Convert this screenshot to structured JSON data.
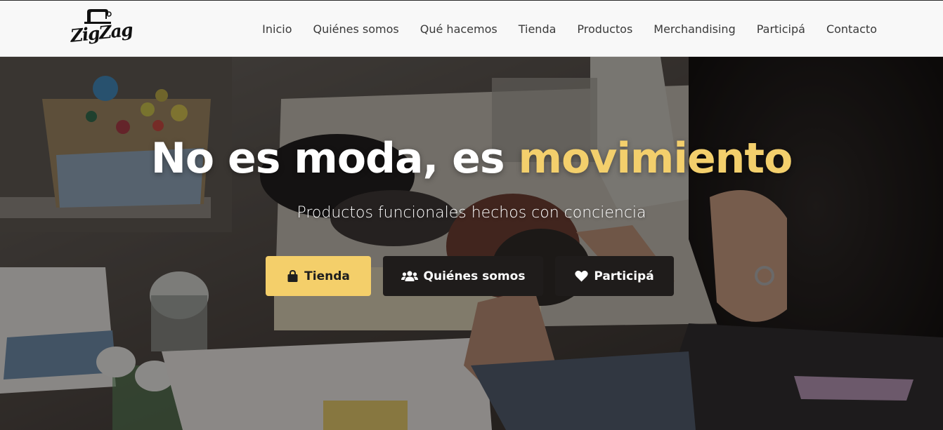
{
  "brand": {
    "logo_text": "ZigZag"
  },
  "nav": {
    "items": [
      {
        "label": "Inicio"
      },
      {
        "label": "Quiénes somos"
      },
      {
        "label": "Qué hacemos"
      },
      {
        "label": "Tienda"
      },
      {
        "label": "Productos"
      },
      {
        "label": "Merchandising"
      },
      {
        "label": "Participá"
      },
      {
        "label": "Contacto"
      }
    ]
  },
  "hero": {
    "title_main": "No es moda, es ",
    "title_accent": "movimiento",
    "subtitle": "Productos funcionales hechos con conciencia",
    "buttons": [
      {
        "label": "Tienda",
        "icon": "shopping-bag-icon"
      },
      {
        "label": "Quiénes somos",
        "icon": "users-icon"
      },
      {
        "label": "Participá",
        "icon": "heart-icon"
      }
    ]
  },
  "colors": {
    "accent": "#f3cf6c",
    "dark_button": "#1f1c1b",
    "header_bg": "#f8f8f8",
    "nav_text": "#3a3a3a"
  }
}
